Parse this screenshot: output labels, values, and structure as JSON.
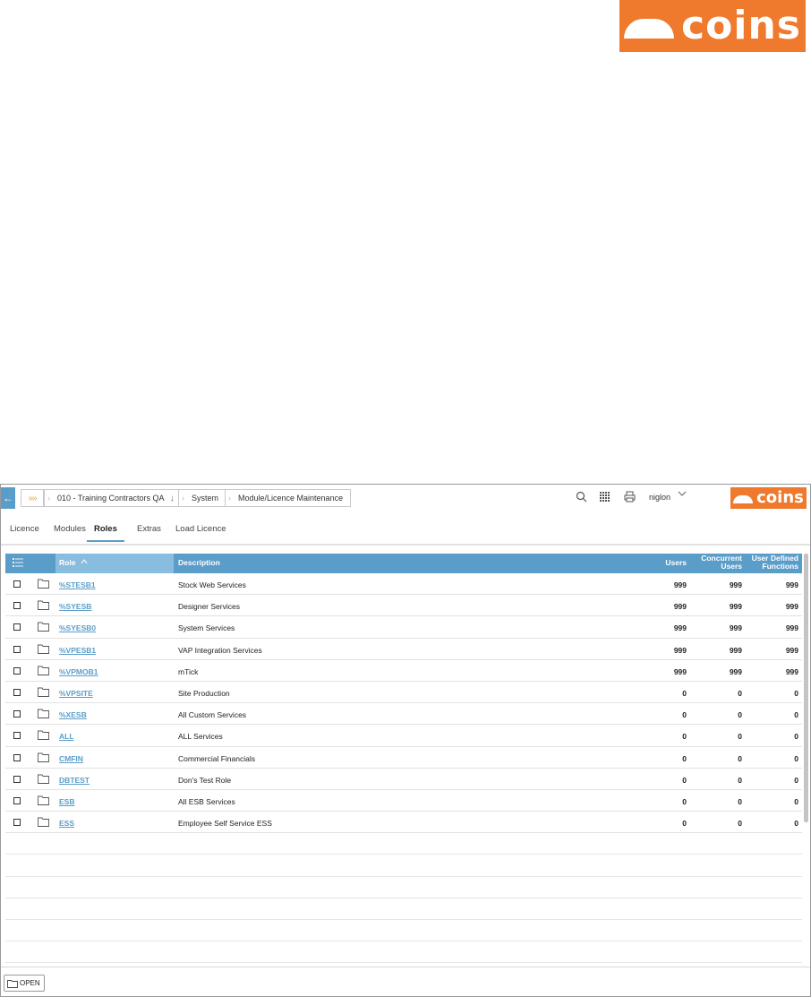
{
  "brand": {
    "logo_text": "coins",
    "accent": "#ef7a2e",
    "primary": "#5b9dc9"
  },
  "topbar": {
    "home_chevrons": "»»",
    "breadcrumbs": [
      "010 - Training Contractors QA",
      "System",
      "Module/Licence Maintenance"
    ],
    "icons": [
      "search-icon",
      "grid-menu-icon",
      "print-icon"
    ],
    "user": "niglon"
  },
  "tabs": [
    {
      "label": "Licence",
      "active": false
    },
    {
      "label": "Modules",
      "active": false
    },
    {
      "label": "Roles",
      "active": true
    },
    {
      "label": "Extras",
      "active": false
    },
    {
      "label": "Load Licence",
      "active": false
    }
  ],
  "grid": {
    "columns": {
      "role": "Role",
      "description": "Description",
      "users": "Users",
      "concurrent": "Concurrent Users",
      "udf": "User Defined Functions"
    },
    "sort": {
      "column": "Role",
      "direction": "ascending"
    },
    "rows": [
      {
        "role": "%STESB1",
        "description": "Stock Web Services",
        "users": "999",
        "concurrent": "999",
        "udf": "999"
      },
      {
        "role": "%SYESB",
        "description": "Designer Services",
        "users": "999",
        "concurrent": "999",
        "udf": "999"
      },
      {
        "role": "%SYESB0",
        "description": "System Services",
        "users": "999",
        "concurrent": "999",
        "udf": "999"
      },
      {
        "role": "%VPESB1",
        "description": "VAP Integration Services",
        "users": "999",
        "concurrent": "999",
        "udf": "999"
      },
      {
        "role": "%VPMOB1",
        "description": "mTick",
        "users": "999",
        "concurrent": "999",
        "udf": "999"
      },
      {
        "role": "%VPSITE",
        "description": "Site Production",
        "users": "0",
        "concurrent": "0",
        "udf": "0"
      },
      {
        "role": "%XESB",
        "description": "All Custom Services",
        "users": "0",
        "concurrent": "0",
        "udf": "0"
      },
      {
        "role": "ALL",
        "description": "ALL Services",
        "users": "0",
        "concurrent": "0",
        "udf": "0"
      },
      {
        "role": "CMFIN",
        "description": "Commercial Financials",
        "users": "0",
        "concurrent": "0",
        "udf": "0"
      },
      {
        "role": "DBTEST",
        "description": "Don's Test Role",
        "users": "0",
        "concurrent": "0",
        "udf": "0"
      },
      {
        "role": "ESB",
        "description": "All ESB Services",
        "users": "0",
        "concurrent": "0",
        "udf": "0"
      },
      {
        "role": "ESS",
        "description": "Employee Self Service ESS",
        "users": "0",
        "concurrent": "0",
        "udf": "0"
      }
    ]
  },
  "footer": {
    "open_label": "OPEN"
  }
}
